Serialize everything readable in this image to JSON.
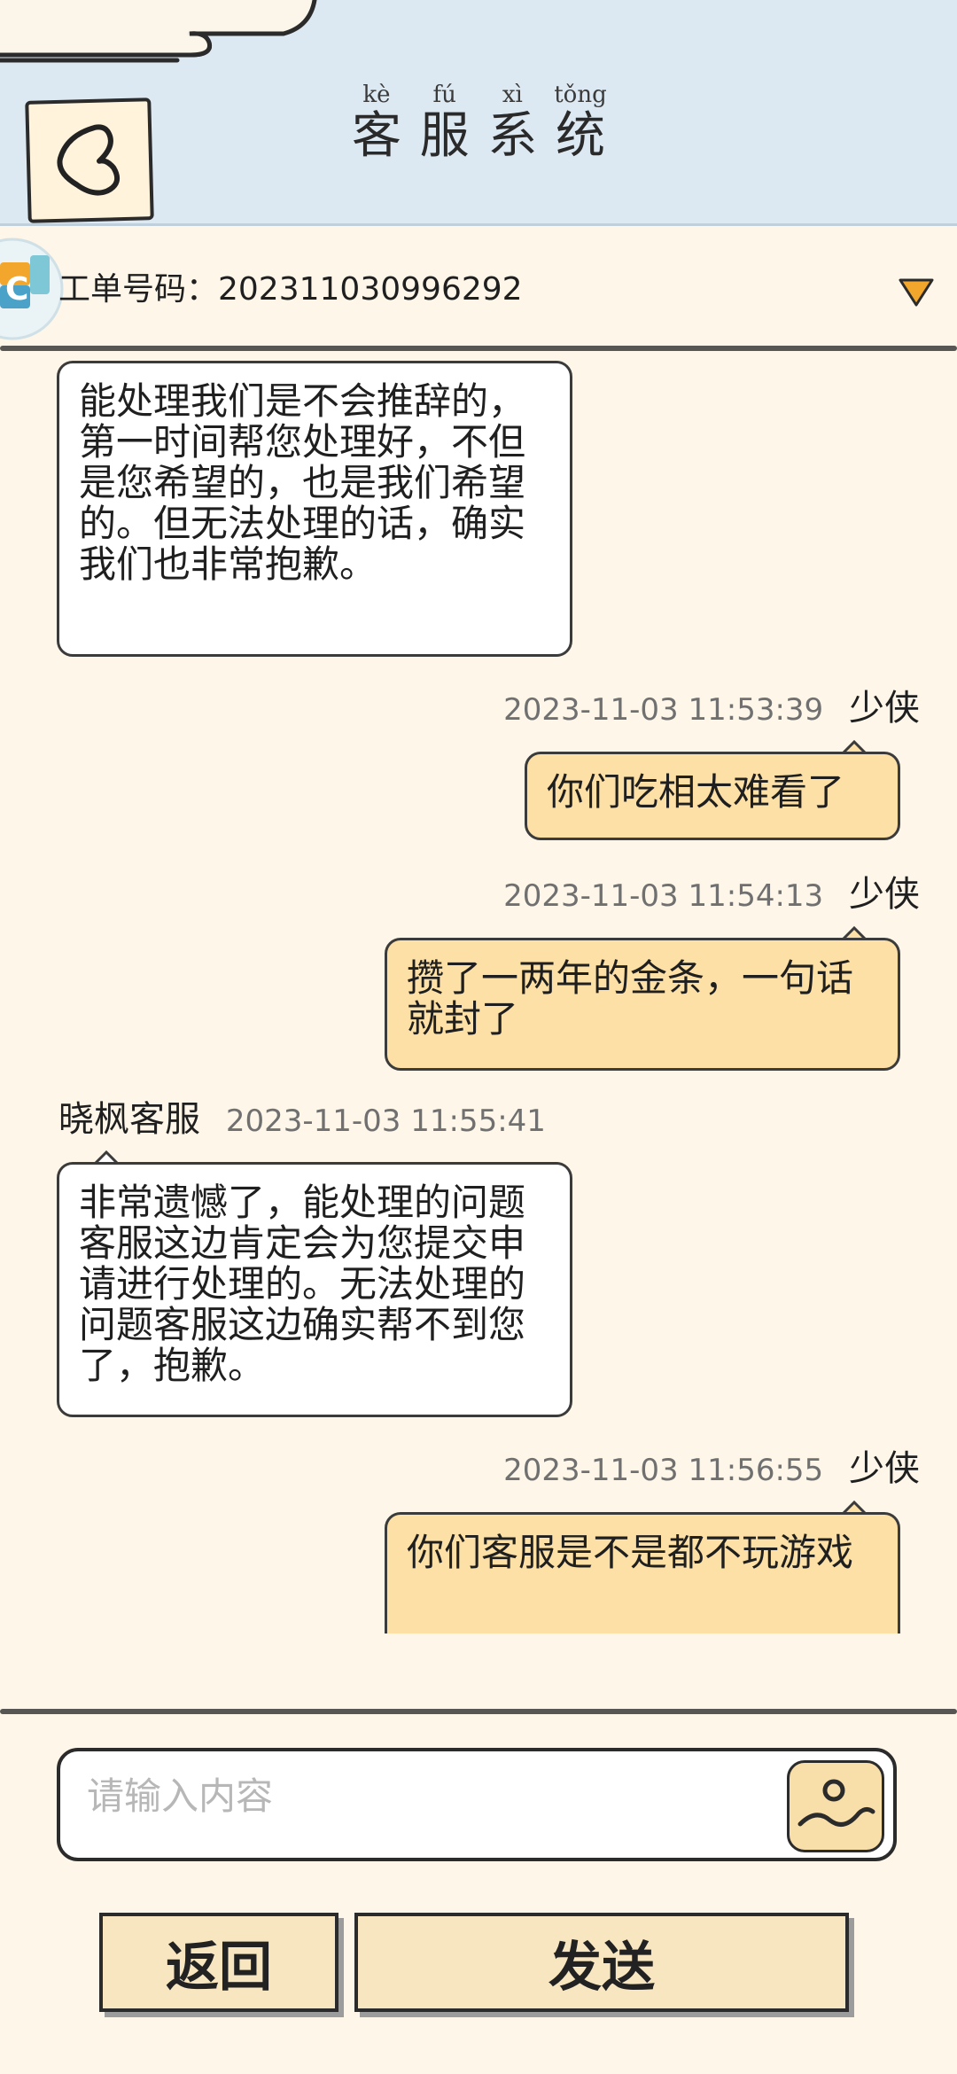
{
  "header": {
    "title": [
      {
        "pinyin": "kè",
        "char": "客"
      },
      {
        "pinyin": "fú",
        "char": "服"
      },
      {
        "pinyin": "xì",
        "char": "系"
      },
      {
        "pinyin": "tǒng",
        "char": "统"
      }
    ]
  },
  "ticket": {
    "label": "工单号码：20231103099629​2",
    "text": "工单号码：202311030996292"
  },
  "messages": [
    {
      "side": "cs",
      "text": "能处理我们是不会推辞的，第一时间帮您处理好，不但是您希望的，也是我们希望的。但无法处理的话，确实我们也非常抱歉。"
    },
    {
      "side": "user",
      "name": "少侠",
      "time": "2023-11-03 11:53:39",
      "text": "你们吃相太难看了"
    },
    {
      "side": "user",
      "name": "少侠",
      "time": "2023-11-03 11:54:13",
      "text": "攒了一两年的金条，一句话就封了"
    },
    {
      "side": "cs",
      "name": "晓枫客服",
      "time": "2023-11-03 11:55:41",
      "text": "非常遗憾了，能处理的问题客服这边肯定会为您提交申请进行处理的。无法处理的问题客服这边确实帮不到您了，抱歉。"
    },
    {
      "side": "user",
      "name": "少侠",
      "time": "2023-11-03 11:56:55",
      "text": "你们客服是不是都不玩游戏"
    }
  ],
  "input": {
    "placeholder": "请输入内容",
    "value": ""
  },
  "buttons": {
    "back_label": "返回",
    "send_label": "发送"
  },
  "colors": {
    "background": "#fdf6e9",
    "header": "#dde9f2",
    "user_bubble": "#fde0a6",
    "cs_bubble": "#ffffff",
    "button": "#f7e6c0",
    "accent_arrow": "#f2a72c"
  },
  "icons": {
    "back": "heart-back-icon",
    "logo": "game-logo-icon",
    "dropdown": "dropdown-triangle-icon",
    "image": "image-upload-icon"
  }
}
